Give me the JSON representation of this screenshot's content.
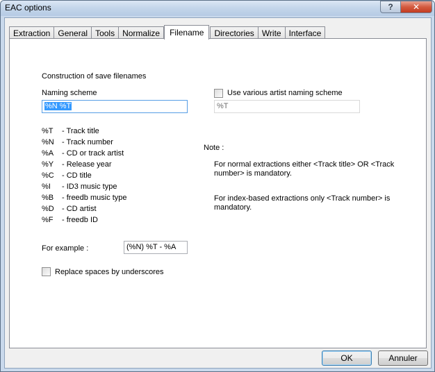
{
  "window": {
    "title": "EAC options"
  },
  "tabs": [
    {
      "label": "Extraction"
    },
    {
      "label": "General"
    },
    {
      "label": "Tools"
    },
    {
      "label": "Normalize"
    },
    {
      "label": "Filename",
      "active": true
    },
    {
      "label": "Directories"
    },
    {
      "label": "Write"
    },
    {
      "label": "Interface"
    }
  ],
  "filename": {
    "section_heading": "Construction of save filenames",
    "naming_scheme_label": "Naming scheme",
    "naming_scheme_value": "%N %T",
    "various_artist_checkbox_label": "Use various artist naming scheme",
    "various_artist_checked": false,
    "various_artist_value": "%T",
    "codes": [
      {
        "code": "%T",
        "desc": "- Track title"
      },
      {
        "code": "%N",
        "desc": "- Track number"
      },
      {
        "code": "%A",
        "desc": "- CD or track artist"
      },
      {
        "code": "%Y",
        "desc": "- Release year"
      },
      {
        "code": "%C",
        "desc": "- CD title"
      },
      {
        "code": "%I",
        "desc": "- ID3 music type"
      },
      {
        "code": "%B",
        "desc": "- freedb music type"
      },
      {
        "code": "%D",
        "desc": "- CD artist"
      },
      {
        "code": "%F",
        "desc": "- freedb ID"
      }
    ],
    "note_label": "Note :",
    "note_1": "For normal extractions either <Track title>  OR  <Track number> is mandatory.",
    "note_2": "For index-based extractions only <Track number> is mandatory.",
    "example_label": "For example :",
    "example_value": "(%N) %T - %A",
    "replace_spaces_label": "Replace spaces by underscores",
    "replace_spaces_checked": false
  },
  "buttons": {
    "ok": "OK",
    "cancel": "Annuler"
  },
  "colors": {
    "selection": "#3399ff",
    "close_button": "#c23b20",
    "focus_border": "#569de5"
  }
}
